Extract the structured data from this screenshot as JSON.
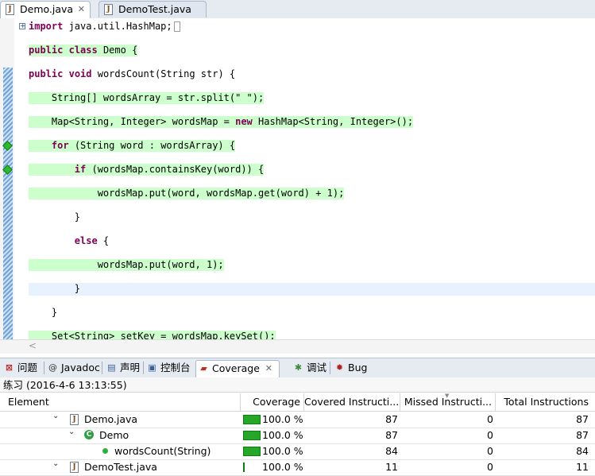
{
  "editor_tabs": [
    {
      "label": "Demo.java",
      "active": true
    },
    {
      "label": "DemoTest.java",
      "active": false
    }
  ],
  "file_icon_glyph": "J",
  "close_glyph": "✕",
  "code": {
    "l1_kw": "import",
    "l1_rest": " java.util.HashMap;",
    "l2_kw1": "public",
    "l2_kw2": "class",
    "l2_rest": " Demo {",
    "l3_kw1": "public",
    "l3_kw2": "void",
    "l3_rest": " wordsCount(String str) {",
    "l4": "    String[] wordsArray = str.split(\" \");",
    "l5_a": "    Map<String, Integer> wordsMap = ",
    "l5_kw": "new",
    "l5_b": " HashMap<String, Integer>();",
    "l6_a": "    ",
    "l6_kw": "for",
    "l6_b": " (String word : wordsArray) {",
    "l7_a": "        ",
    "l7_kw": "if",
    "l7_b": " (wordsMap.containsKey(word)) {",
    "l8": "            wordsMap.put(word, wordsMap.get(word) + 1);",
    "l9": "        }",
    "l10_a": "        ",
    "l10_kw": "else",
    "l10_b": " {",
    "l11": "            wordsMap.put(word, 1);",
    "l12": "        }",
    "l13": "    }",
    "l14": "    Set<String> setKey = wordsMap.keySet();"
  },
  "views": {
    "problems": "问题",
    "javadoc": "Javadoc",
    "declaration": "声明",
    "console": "控制台",
    "coverage": "Coverage",
    "debug": "调试",
    "bug_explorer": "Bug Explorer"
  },
  "session_label": "练习 (2016-4-6 13:13:55)",
  "columns": {
    "element": "Element",
    "coverage": "Coverage",
    "covered": "Covered Instructi...",
    "missed": "Missed Instructi...",
    "total": "Total Instructions"
  },
  "rows": [
    {
      "name": "Demo.java",
      "coverage": "100.0 %",
      "covered": "87",
      "missed": "0",
      "total": "87",
      "bar": 1.0
    },
    {
      "name": "Demo",
      "coverage": "100.0 %",
      "covered": "87",
      "missed": "0",
      "total": "87",
      "bar": 1.0
    },
    {
      "name": "wordsCount(String)",
      "coverage": "100.0 %",
      "covered": "84",
      "missed": "0",
      "total": "84",
      "bar": 1.0
    },
    {
      "name": "DemoTest.java",
      "coverage": "100.0 %",
      "covered": "11",
      "missed": "0",
      "total": "11",
      "bar": 0.1
    }
  ],
  "colors": {
    "covered_line": "#ccffcc",
    "coverage_bar": "#27a727",
    "keyword": "#7f0055"
  }
}
